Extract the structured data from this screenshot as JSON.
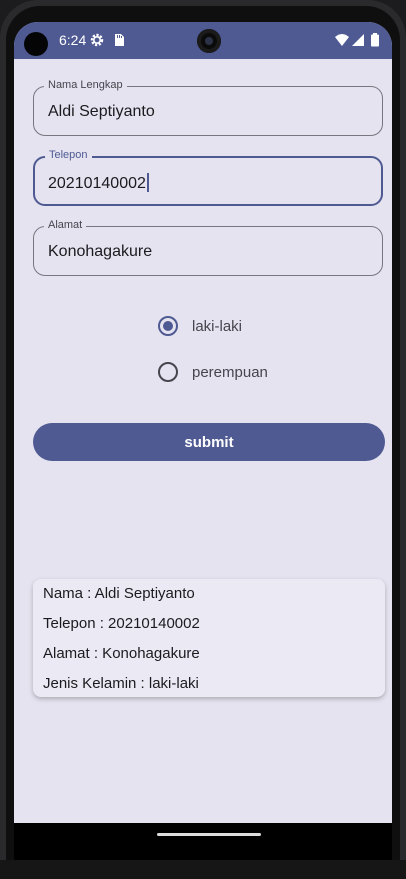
{
  "status_bar": {
    "time": "6:24",
    "color": "#4f5a93",
    "icons": [
      "settings-icon",
      "sd-card-icon",
      "wifi-icon",
      "signal-icon",
      "battery-icon"
    ]
  },
  "form": {
    "nama": {
      "label": "Nama Lengkap",
      "value": "Aldi Septiyanto"
    },
    "telepon": {
      "label": "Telepon",
      "value": "20210140002"
    },
    "alamat": {
      "label": "Alamat",
      "value": "Konohagakure"
    }
  },
  "gender": {
    "options": [
      {
        "label": "laki-laki",
        "selected": true
      },
      {
        "label": "perempuan",
        "selected": false
      }
    ]
  },
  "submit_label": "submit",
  "result": {
    "nama": "Nama : Aldi Septiyanto",
    "telepon": "Telepon : 20210140002",
    "alamat": "Alamat : Konohagakure",
    "jenis_kelamin": "Jenis Kelamin : laki-laki"
  },
  "colors": {
    "primary": "#4f5a93",
    "background": "#e5e3ef"
  }
}
